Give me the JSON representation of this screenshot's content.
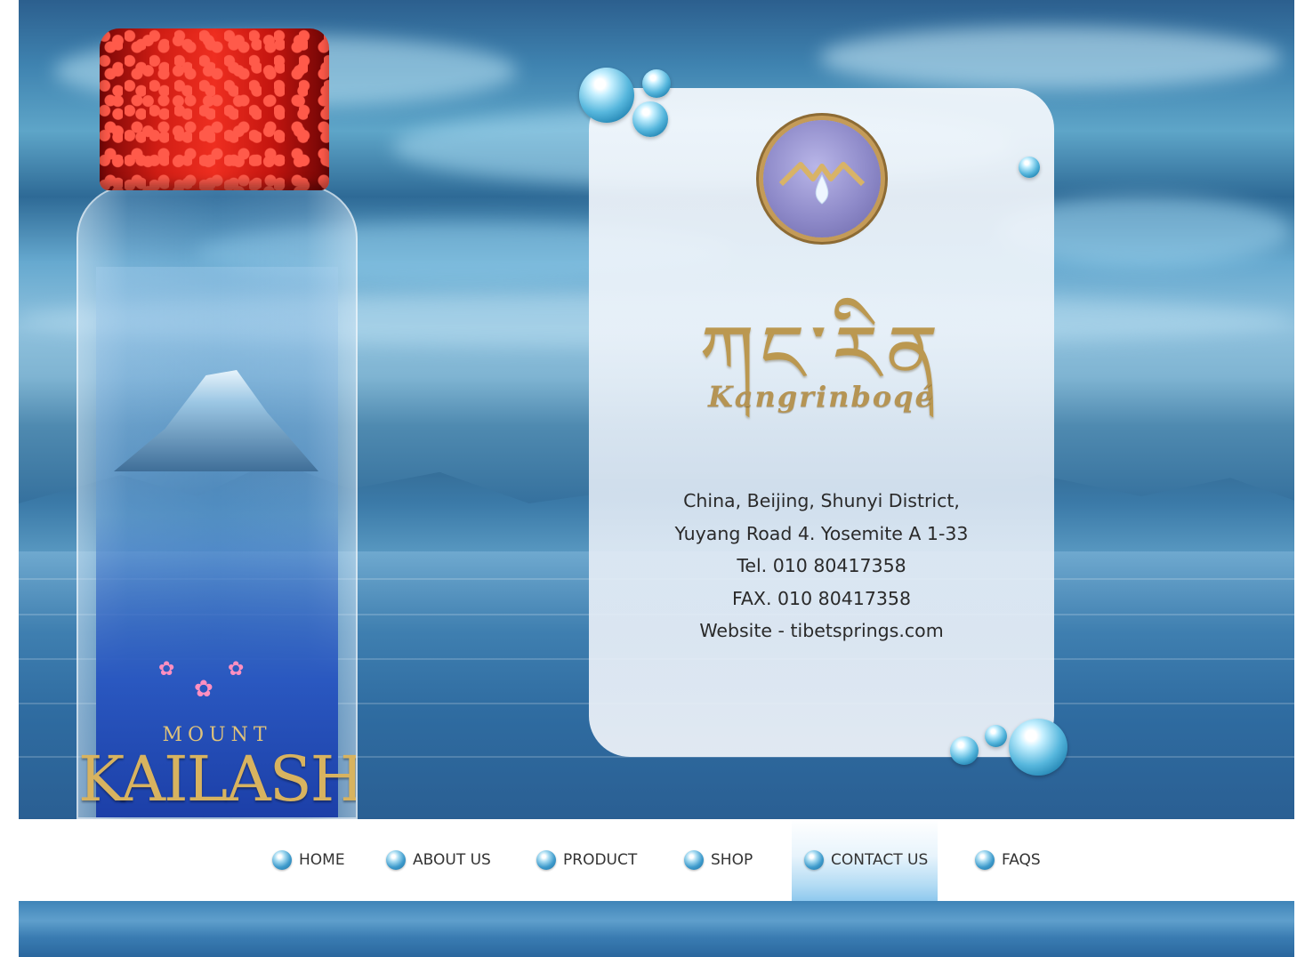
{
  "bottle": {
    "mount_label": "MOUNT",
    "brand_label": "KAILASH"
  },
  "card": {
    "script_logo": "ཀང་རིན",
    "brand_name": "Kangrinboqé",
    "address_lines": [
      "China, Beijing, Shunyi District,",
      "Yuyang Road 4. Yosemite A 1-33",
      "Tel. 010 80417358",
      "FAX. 010 80417358",
      "Website - tibetsprings.com"
    ]
  },
  "nav": {
    "items": [
      {
        "label": "HOME"
      },
      {
        "label": "ABOUT US"
      },
      {
        "label": "PRODUCT"
      },
      {
        "label": "SHOP"
      },
      {
        "label": "CONTACT US",
        "active": true
      },
      {
        "label": "FAQS"
      }
    ]
  },
  "colors": {
    "accent_gold": "#bb9850",
    "cap_red": "#d01d14",
    "active_nav_gradient": "#8ec8ee",
    "sky_blue": "#3f83b0"
  },
  "icons": {
    "nav_bullet": "water-drop-bullet-icon",
    "emblem": "mountain-drop-logo-icon"
  }
}
